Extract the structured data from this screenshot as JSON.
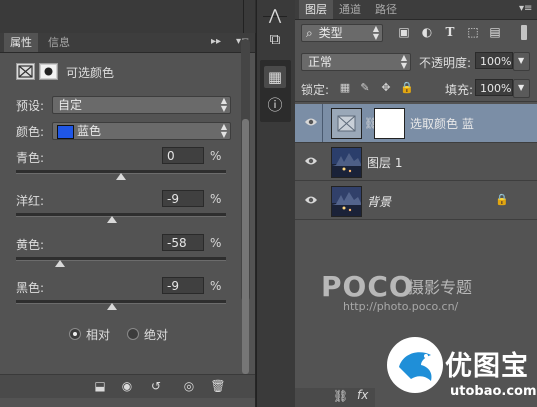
{
  "properties_panel": {
    "tabs": [
      {
        "label": "属性",
        "active": true
      },
      {
        "label": "信息",
        "active": false
      }
    ],
    "title": "可选颜色",
    "preset": {
      "label": "预设:",
      "value": "自定"
    },
    "colors": {
      "label": "颜色:",
      "value": "蓝色",
      "swatch": "#1f56e6"
    },
    "sliders": [
      {
        "label": "青色:",
        "value": "0",
        "unit": "%",
        "level": 0
      },
      {
        "label": "洋红:",
        "value": "-9",
        "unit": "%",
        "level": -9
      },
      {
        "label": "黄色:",
        "value": "-58",
        "unit": "%",
        "level": -58
      },
      {
        "label": "黑色:",
        "value": "-9",
        "unit": "%",
        "level": -9
      }
    ],
    "method": [
      {
        "label": "相对",
        "selected": true
      },
      {
        "label": "绝对",
        "selected": false
      }
    ]
  },
  "layers_panel": {
    "tabs": [
      {
        "label": "图层",
        "active": true
      },
      {
        "label": "通道",
        "active": false
      },
      {
        "label": "路径",
        "active": false
      }
    ],
    "filter_kind": "类型",
    "blend_mode": "正常",
    "opacity": {
      "label": "不透明度:",
      "value": "100%"
    },
    "lock_label": "锁定:",
    "fill": {
      "label": "填充:",
      "value": "100%"
    },
    "layers": [
      {
        "name": "选取颜色 蓝",
        "type": "adjustment",
        "visible": true,
        "selected": true
      },
      {
        "name": "图层 1",
        "type": "image",
        "visible": true,
        "selected": false
      },
      {
        "name": "背景",
        "type": "image",
        "visible": true,
        "selected": false,
        "locked": true
      }
    ]
  },
  "watermark": {
    "poco": "POCO",
    "poco_cn": "摄影专题",
    "url": "http://photo.poco.cn/",
    "site_name": "优图宝",
    "site_url": "utobao.com"
  },
  "colors": {
    "panel_bg": "#535353",
    "selected_layer": "#7b8ea6",
    "blue_swatch": "#1f56e6"
  }
}
